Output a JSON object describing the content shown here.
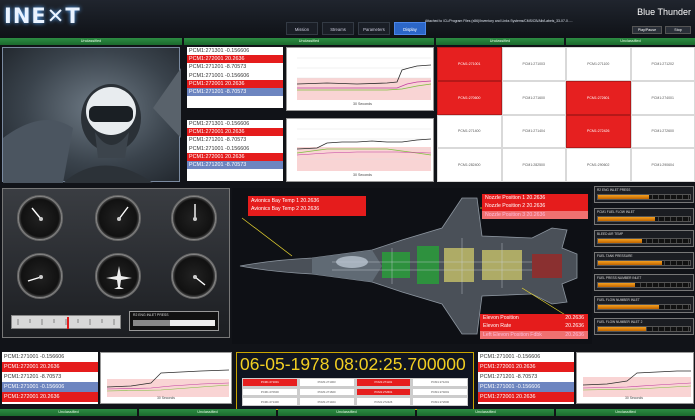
{
  "header": {
    "logo": "INE✕T",
    "nav": [
      "Mission",
      "Streams",
      "Parameters",
      "Display"
    ],
    "active_nav": "Display",
    "path_text": "Attached to /CL/Program Files (x86)/Inventory and Links Systems/CMS/CB/Alb/Labels_33-07-0.....",
    "title": "Blue Thunder",
    "buttons": [
      "Play/Pause",
      "Stop"
    ]
  },
  "status_bars": {
    "top": [
      "Unclassified",
      "Unclassified",
      "Unclassified",
      "Unclassified"
    ],
    "bottom": [
      "Unclassified",
      "Unclassified",
      "Unclassified",
      "Unclassified",
      "Unclassified"
    ]
  },
  "param_lists": {
    "top1": [
      {
        "text": "PCM1:271301 -0.156606",
        "style": "r0"
      },
      {
        "text": "PCM1:272001 20.2636",
        "style": "r1"
      },
      {
        "text": "PCM1:271201 -8.70573",
        "style": "r0"
      },
      {
        "text": "PCM1:271001 -0.156606",
        "style": "r0"
      },
      {
        "text": "PCM1:272001 20.2636",
        "style": "r1"
      },
      {
        "text": "PCM1:271201 -8.70573",
        "style": "r3"
      }
    ],
    "top2": [
      {
        "text": "PCM1:271301 -0.156606",
        "style": "r0"
      },
      {
        "text": "PCM1:272001 20.2636",
        "style": "r1"
      },
      {
        "text": "PCM1:271201 -8.70573",
        "style": "r0"
      },
      {
        "text": "PCM1:271001 -0.156606",
        "style": "r0"
      },
      {
        "text": "PCM1:272001 20.2636",
        "style": "r1"
      },
      {
        "text": "PCM1:271201 -8.70573",
        "style": "r3"
      }
    ],
    "bottom_left": [
      {
        "text": "PCM1:271001 -0.156606",
        "style": "r0"
      },
      {
        "text": "PCM1:272001 20.2636",
        "style": "r1"
      },
      {
        "text": "PCM1:271201 -8.70573",
        "style": "r0"
      },
      {
        "text": "PCM1:271001 -0.156606",
        "style": "r3"
      },
      {
        "text": "PCM1:272001 20.2636",
        "style": "r1"
      }
    ],
    "bottom_right": [
      {
        "text": "PCM1:271001 -0.156606",
        "style": "r0"
      },
      {
        "text": "PCM1:272001 20.2636",
        "style": "r1"
      },
      {
        "text": "PCM1:271201 -8.70573",
        "style": "r0"
      },
      {
        "text": "PCM1:271001 -0.156606",
        "style": "r3"
      },
      {
        "text": "PCM1:272001 20.2636",
        "style": "r1"
      }
    ]
  },
  "charts": {
    "axis_caption": "30 Seconds"
  },
  "param_grid": {
    "cells": [
      {
        "label": "PCM1:271001",
        "red": true
      },
      {
        "label": "PCM1:271003",
        "red": false
      },
      {
        "label": "PCM1:271100",
        "red": false
      },
      {
        "label": "PCM1:271202",
        "red": false
      },
      {
        "label": "PCM1:270600",
        "red": true
      },
      {
        "label": "PCM1:271600",
        "red": false
      },
      {
        "label": "PCM1:272601",
        "red": true
      },
      {
        "label": "PCM1:274001",
        "red": false
      },
      {
        "label": "PCM1:271400",
        "red": false
      },
      {
        "label": "PCM1:271404",
        "red": false
      },
      {
        "label": "PCM1:272426",
        "red": true
      },
      {
        "label": "PCM1:272600",
        "red": false
      },
      {
        "label": "PCM1:282400",
        "red": false
      },
      {
        "label": "PCM1:282500",
        "red": false
      },
      {
        "label": "PCM1:290602",
        "red": false
      },
      {
        "label": "PCM1:290604",
        "red": false
      }
    ]
  },
  "instrument_panel": {
    "press_label": "R2 ENG INLET PRESS"
  },
  "avionics": {
    "temp1": "Avionics Bay Temp 1 20.2636",
    "temp2": "Avionics Bay Temp 2 20.2636"
  },
  "nozzle": {
    "rows": [
      {
        "text": "Nozzle Position 1 20.2636",
        "light": false
      },
      {
        "text": "Nozzle Position 2 20.2636",
        "light": false
      },
      {
        "text": "Nozzle Position 3 20.2636",
        "light": true
      }
    ]
  },
  "elevon": {
    "rows": [
      {
        "label": "Elevon Position",
        "value": "20.2636",
        "light": false
      },
      {
        "label": "Elevon Rate",
        "value": "20.2636",
        "light": false
      },
      {
        "label": "Left Elevon Position Fdbk",
        "value": "20.2636",
        "light": true
      }
    ]
  },
  "bar_gauges": [
    {
      "label": "R2 ENG INLET PRESS",
      "fill": 0.55
    },
    {
      "label": "PCM1 FUEL FLOW INLET",
      "fill": 0.62
    },
    {
      "label": "BLEED AIR TEMP",
      "fill": 0.48
    },
    {
      "label": "FUEL TANK PRESSURE",
      "fill": 0.7
    },
    {
      "label": "FUEL PRESS NUMBER INLET",
      "fill": 0.4
    },
    {
      "label": "FUEL FLOW NUMBER INLET",
      "fill": 0.66
    },
    {
      "label": "FUEL FLOW NUMBER INLET 2",
      "fill": 0.52
    }
  ],
  "timestamp": {
    "text": "06-05-1978 08:02:25.700000"
  },
  "time_table": {
    "cells": [
      {
        "label": "PCM1:271001",
        "red": true
      },
      {
        "label": "PCM1:271003",
        "red": false
      },
      {
        "label": "PCM1:271101",
        "red": true
      },
      {
        "label": "PCM1:271201",
        "red": false
      },
      {
        "label": "PCM1:270600",
        "red": false
      },
      {
        "label": "PCM1:271600",
        "red": false
      },
      {
        "label": "PCM1:272601",
        "red": true
      },
      {
        "label": "PCM1:274001",
        "red": false
      },
      {
        "label": "PCM1:271400",
        "red": false
      },
      {
        "label": "PCM1:271404",
        "red": false
      },
      {
        "label": "PCM1:272426",
        "red": false
      },
      {
        "label": "PCM1:272600",
        "red": false
      }
    ]
  }
}
